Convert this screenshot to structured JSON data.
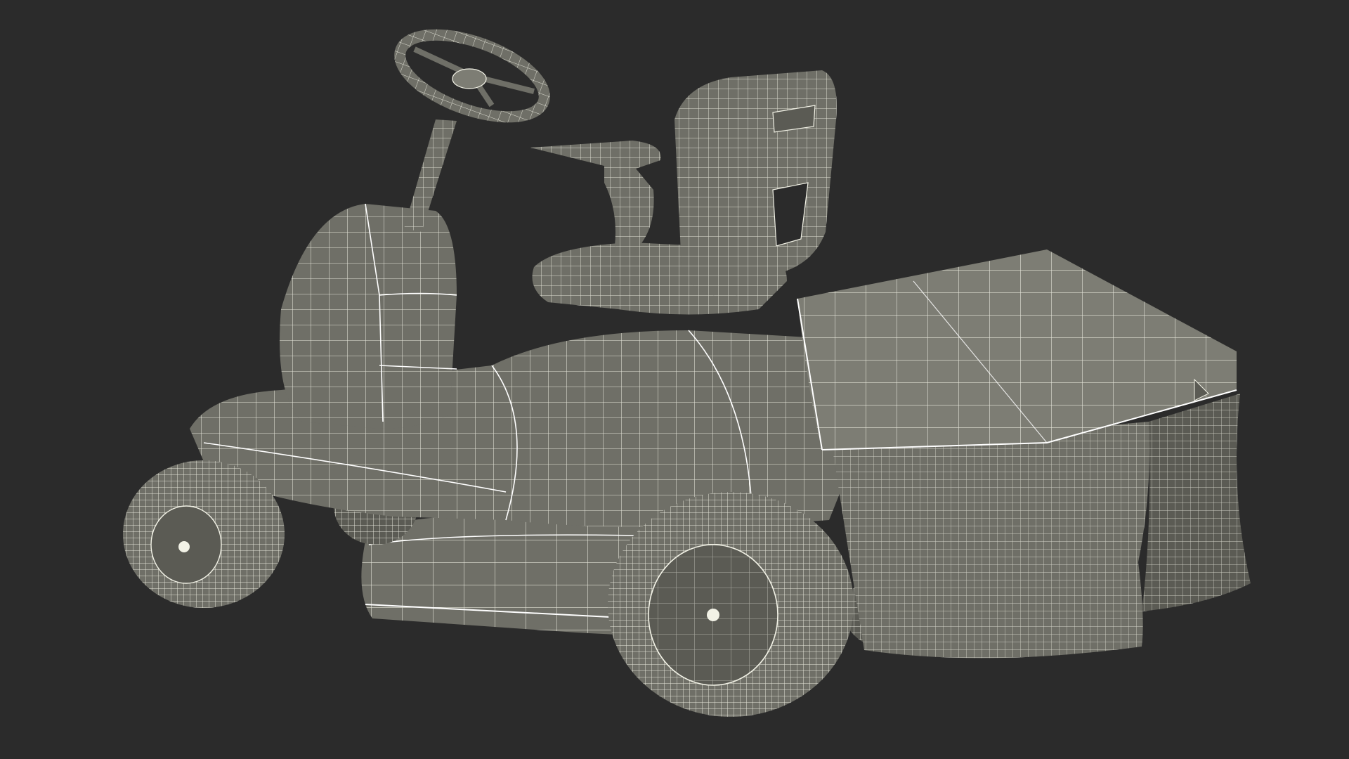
{
  "scene": {
    "background": "#2b2b2b",
    "surface_fill": "#6f6f67",
    "surface_fill_dark": "#5b5b54",
    "surface_fill_light": "#7d7d74",
    "wire_color": "#f2f2e6",
    "edge_color": "#ffffff"
  },
  "model": {
    "subject": "riding-lawn-mower",
    "render_style": "wireframe-over-shaded",
    "parts": [
      "steering-wheel",
      "steering-column",
      "front-hood",
      "seat",
      "seat-back",
      "left-armrest",
      "body-chassis",
      "mower-deck",
      "front-left-wheel",
      "rear-left-wheel",
      "grass-catcher-lid",
      "grass-catcher-bag-left",
      "grass-catcher-bag-right"
    ]
  }
}
